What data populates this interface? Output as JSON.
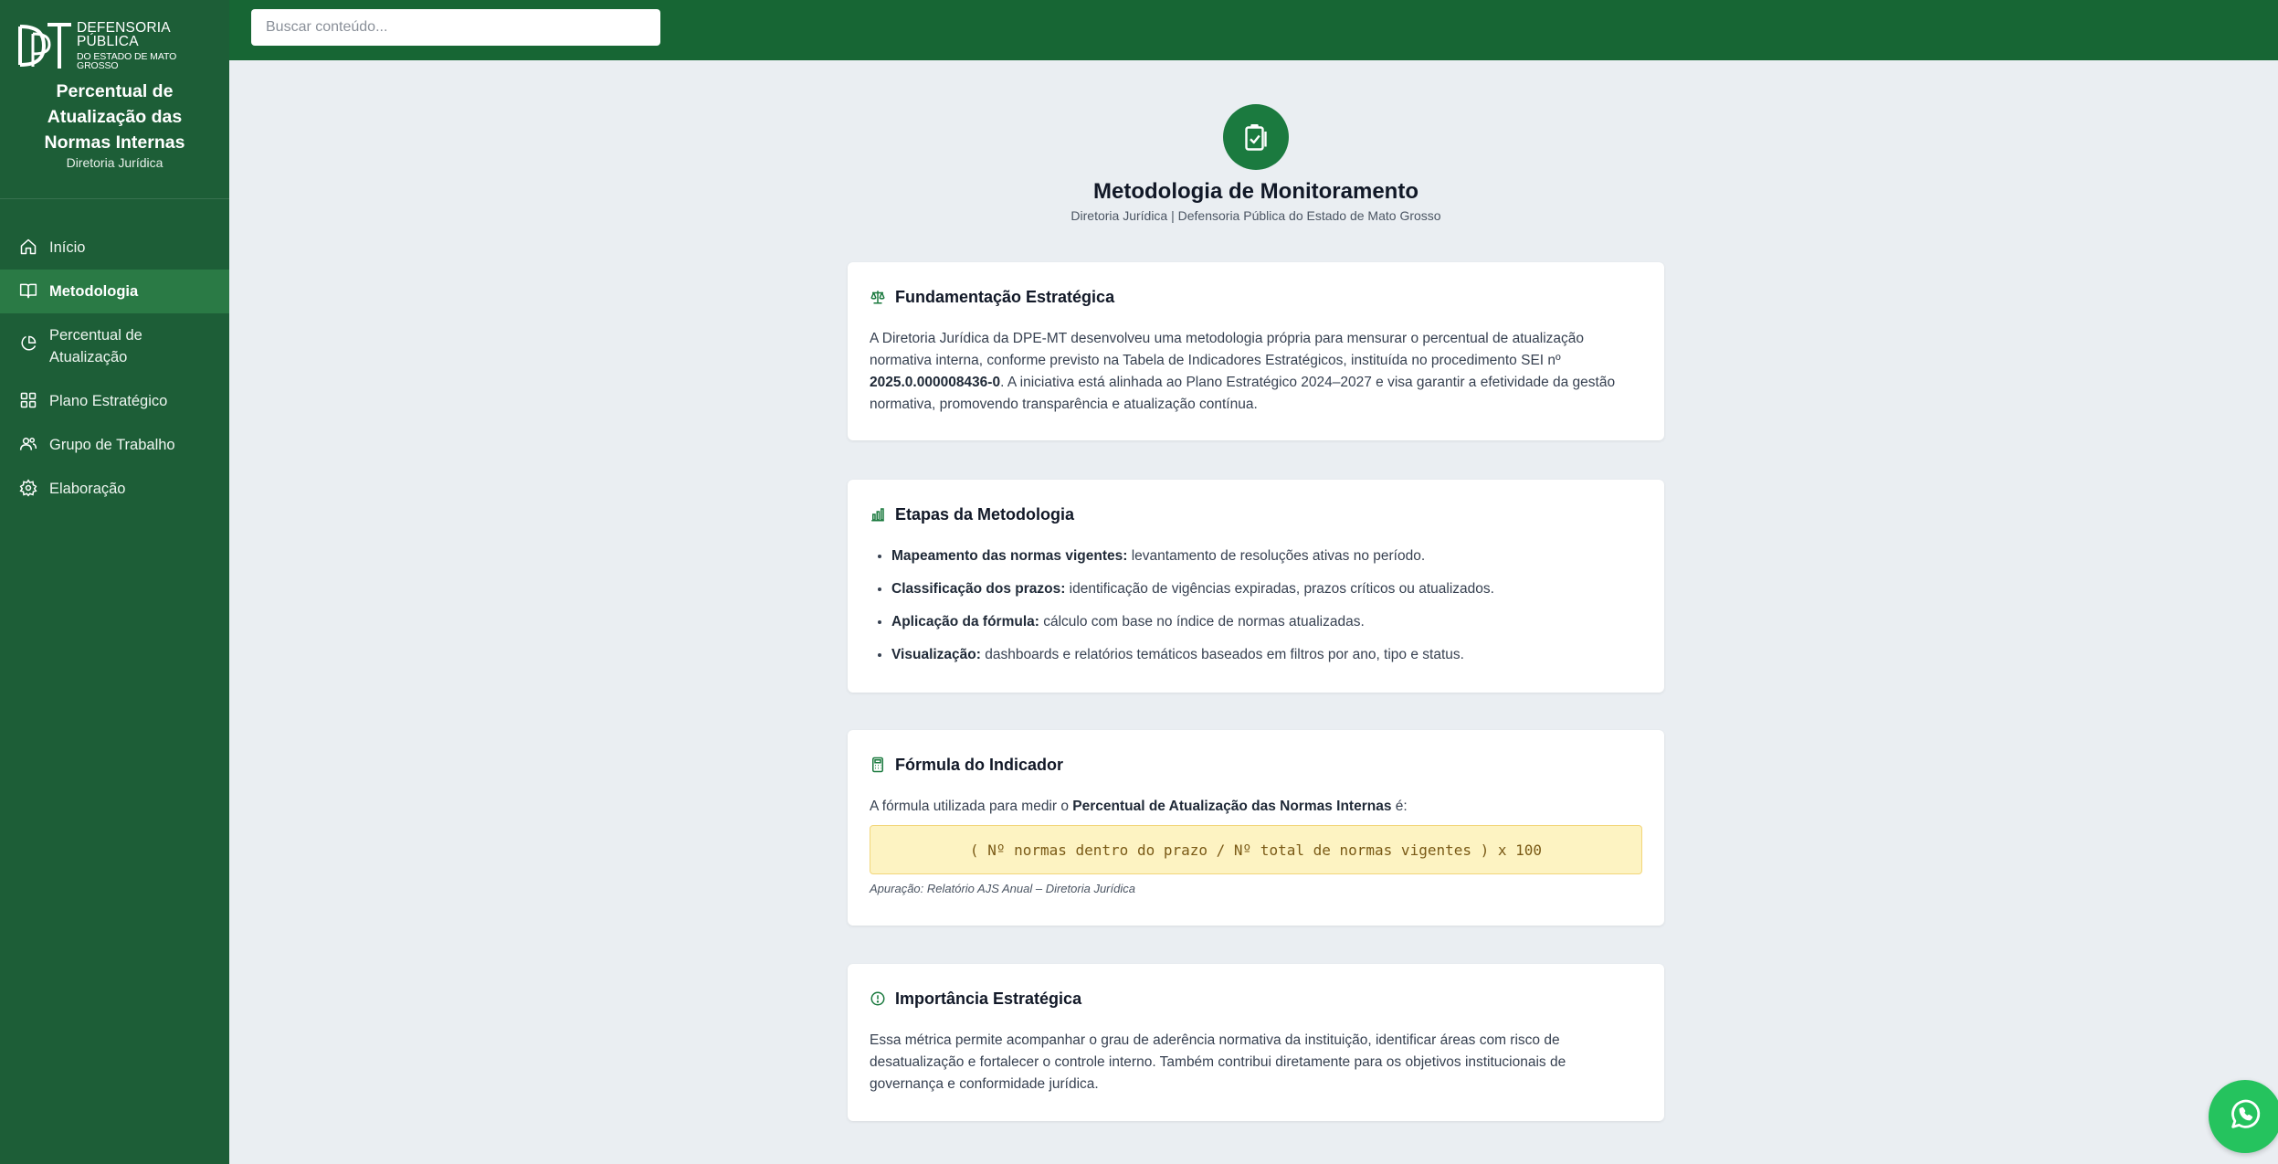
{
  "sidebar": {
    "logo": {
      "line1": "DEFENSORIA PÚBLICA",
      "line2": "DO ESTADO DE MATO GROSSO"
    },
    "title": "Percentual de Atualização das Normas Internas",
    "subtitle": "Diretoria Jurídica",
    "items": [
      {
        "label": "Início",
        "icon": "home-icon",
        "active": false
      },
      {
        "label": "Metodologia",
        "icon": "book-icon",
        "active": true
      },
      {
        "label": "Percentual de Atualização",
        "icon": "pie-chart-icon",
        "active": false
      },
      {
        "label": "Plano Estratégico",
        "icon": "grid-icon",
        "active": false
      },
      {
        "label": "Grupo de Trabalho",
        "icon": "users-icon",
        "active": false
      },
      {
        "label": "Elaboração",
        "icon": "gear-icon",
        "active": false
      }
    ]
  },
  "search": {
    "placeholder": "Buscar conteúdo..."
  },
  "header": {
    "icon": "clipboard-check-icon",
    "title": "Metodologia de Monitoramento",
    "subtitle": "Diretoria Jurídica | Defensoria Pública do Estado de Mato Grosso"
  },
  "cards": {
    "fundamentacao": {
      "icon": "scale-icon",
      "title": "Fundamentação Estratégica",
      "text_a": "A Diretoria Jurídica da DPE-MT desenvolveu uma metodologia própria para mensurar o percentual de atualização normativa interna, conforme previsto na Tabela de Indicadores Estratégicos, instituída no procedimento SEI nº ",
      "text_bold": "2025.0.000008436-0",
      "text_b": ". A iniciativa está alinhada ao Plano Estratégico 2024–2027 e visa garantir a efetividade da gestão normativa, promovendo transparência e atualização contínua."
    },
    "etapas": {
      "icon": "bar-chart-icon",
      "title": "Etapas da Metodologia",
      "steps": [
        {
          "bold": "Mapeamento das normas vigentes:",
          "text": " levantamento de resoluções ativas no período."
        },
        {
          "bold": "Classificação dos prazos:",
          "text": " identificação de vigências expiradas, prazos críticos ou atualizados."
        },
        {
          "bold": "Aplicação da fórmula:",
          "text": " cálculo com base no índice de normas atualizadas."
        },
        {
          "bold": "Visualização:",
          "text": " dashboards e relatórios temáticos baseados em filtros por ano, tipo e status."
        }
      ]
    },
    "formula": {
      "icon": "calculator-icon",
      "title": "Fórmula do Indicador",
      "intro_a": "A fórmula utilizada para medir o ",
      "intro_bold": "Percentual de Atualização das Normas Internas",
      "intro_b": " é:",
      "expression": "( Nº normas dentro do prazo / Nº total de normas vigentes ) x 100",
      "apuracao": "Apuração: Relatório AJS Anual – Diretoria Jurídica"
    },
    "importancia": {
      "icon": "alert-circle-icon",
      "title": "Importância Estratégica",
      "text": "Essa métrica permite acompanhar o grau de aderência normativa da instituição, identificar áreas com risco de desatualização e fortalecer o controle interno. Também contribui diretamente para os objetivos institucionais de governança e conformidade jurídica."
    }
  },
  "whatsapp": {
    "icon": "whatsapp-icon"
  },
  "colors": {
    "sidebar": "#1d5e37",
    "topbar": "#176634",
    "accent": "#1b7a3f",
    "formula_bg": "#fdf3c2"
  }
}
